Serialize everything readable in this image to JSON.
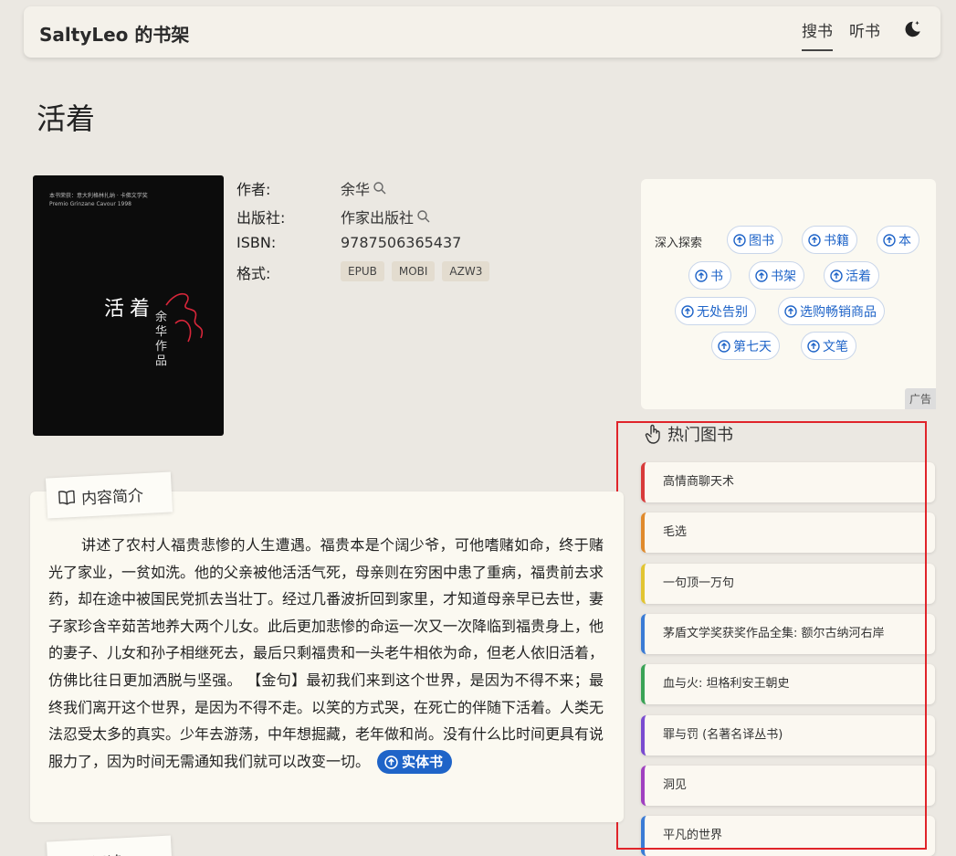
{
  "nav": {
    "brand": "SaltyLeo 的书架",
    "links": [
      "搜书",
      "听书"
    ]
  },
  "book": {
    "title": "活着",
    "cover": {
      "top_line1": "本书荣获：意大利格林扎纳 · 卡佛文学奖",
      "top_line2": "Premio Grinzane Cavour 1998",
      "title": "活着",
      "author": "余华作品"
    },
    "author_label": "作者:",
    "author": "余华",
    "publisher_label": "出版社:",
    "publisher": "作家出版社",
    "isbn_label": "ISBN:",
    "isbn": "9787506365437",
    "format_label": "格式:",
    "formats": [
      "EPUB",
      "MOBI",
      "AZW3"
    ]
  },
  "ad": {
    "label": "深入探索",
    "chips": [
      "图书",
      "书籍",
      "本",
      "书",
      "书架",
      "活着",
      "无处告别",
      "选购畅销商品",
      "第七天",
      "文笔"
    ],
    "tag": "广告"
  },
  "hot": {
    "heading": "热门图书",
    "items": [
      {
        "label": "高情商聊天术",
        "color": "#d83a3a"
      },
      {
        "label": "毛选",
        "color": "#e08a2c"
      },
      {
        "label": "一句顶一万句",
        "color": "#e2c532"
      },
      {
        "label": "茅盾文学奖获奖作品全集: 额尔古纳河右岸",
        "color": "#3a7bd5"
      },
      {
        "label": "血与火: 坦格利安王朝史",
        "color": "#3aa356"
      },
      {
        "label": "罪与罚 (名著名译丛书)",
        "color": "#7a4bd0"
      },
      {
        "label": "洞见",
        "color": "#a040c0"
      },
      {
        "label": "平凡的世界",
        "color": "#3a7bd5"
      }
    ]
  },
  "intro": {
    "heading": "内容简介",
    "text": "讲述了农村人福贵悲惨的人生遭遇。福贵本是个阔少爷，可他嗜赌如命，终于赌光了家业，一贫如洗。他的父亲被他活活气死，母亲则在穷困中患了重病，福贵前去求药，却在途中被国民党抓去当壮丁。经过几番波折回到家里，才知道母亲早已去世，妻子家珍含辛茹苦地养大两个儿女。此后更加悲惨的命运一次又一次降临到福贵身上，他的妻子、儿女和孙子相继死去，最后只剩福贵和一头老牛相依为命，但老人依旧活着，仿佛比往日更加洒脱与坚强。 【金句】最初我们来到这个世界，是因为不得不来；最终我们离开这个世界，是因为不得不走。以笑的方式哭，在死亡的伴随下活着。人类无法忍受太多的真实。少年去游荡，中年想掘藏，老年做和尚。没有什么比时间更具有说服力了，因为时间无需通知我们就可以改变一切。",
    "buy_label": "实体书"
  },
  "next_section": {
    "heading": "相似阅读"
  }
}
